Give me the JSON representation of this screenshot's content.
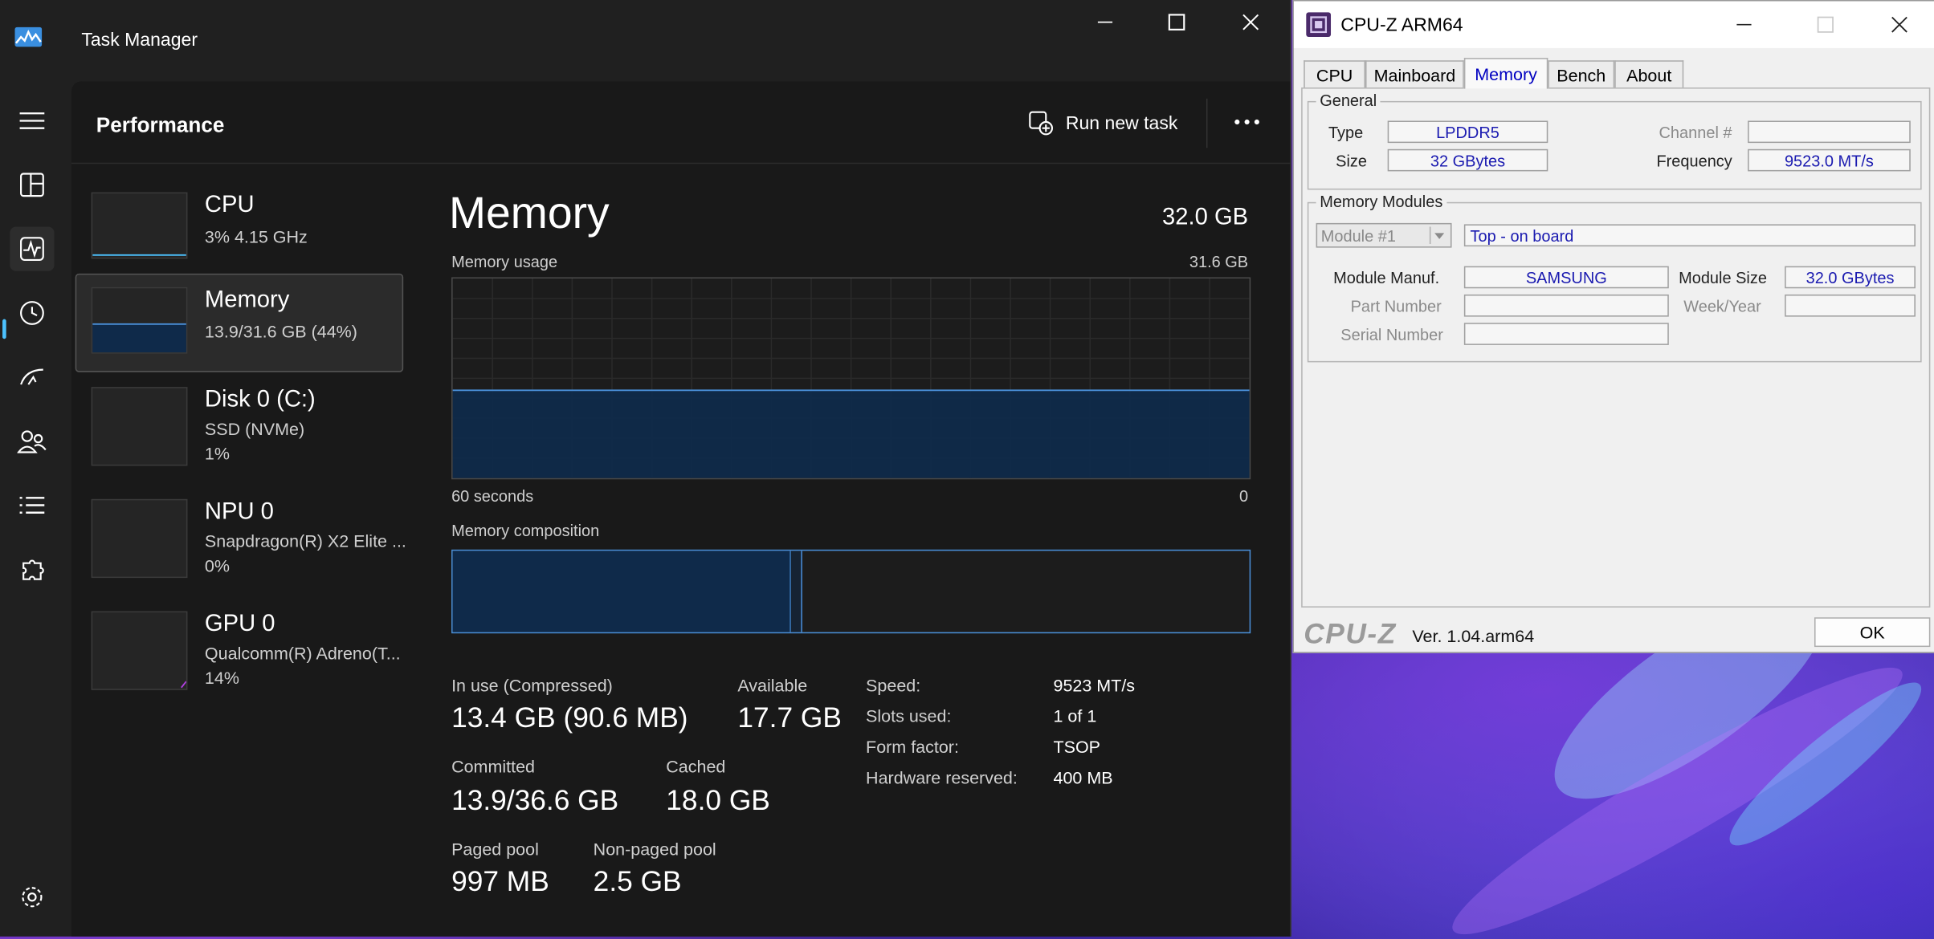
{
  "taskmanager": {
    "title": "Task Manager",
    "header": {
      "title": "Performance",
      "run_new_task": "Run new task",
      "more": "..."
    },
    "devices": [
      {
        "name": "CPU",
        "line1": "3%  4.15 GHz",
        "line2": ""
      },
      {
        "name": "Memory",
        "line1": "13.9/31.6 GB (44%)",
        "line2": ""
      },
      {
        "name": "Disk 0 (C:)",
        "line1": "SSD (NVMe)",
        "line2": "1%"
      },
      {
        "name": "NPU 0",
        "line1": "Snapdragon(R) X2 Elite ...",
        "line2": "0%"
      },
      {
        "name": "GPU 0",
        "line1": "Qualcomm(R) Adreno(T...",
        "line2": "14%"
      }
    ],
    "memory": {
      "title": "Memory",
      "total": "32.0 GB",
      "usage_label": "Memory usage",
      "usage_max": "31.6 GB",
      "axis_left": "60 seconds",
      "axis_right": "0",
      "usage_fraction": 0.44,
      "composition_label": "Memory composition",
      "composition": {
        "in_use_fraction": 0.424,
        "modified_fraction": 0.014
      },
      "stats": {
        "in_use_label": "In use (Compressed)",
        "in_use_value": "13.4 GB (90.6 MB)",
        "available_label": "Available",
        "available_value": "17.7 GB",
        "committed_label": "Committed",
        "committed_value": "13.9/36.6 GB",
        "cached_label": "Cached",
        "cached_value": "18.0 GB",
        "paged_label": "Paged pool",
        "paged_value": "997 MB",
        "nonpaged_label": "Non-paged pool",
        "nonpaged_value": "2.5 GB"
      },
      "specs": [
        {
          "label": "Speed:",
          "value": "9523 MT/s"
        },
        {
          "label": "Slots used:",
          "value": "1 of 1"
        },
        {
          "label": "Form factor:",
          "value": "TSOP"
        },
        {
          "label": "Hardware reserved:",
          "value": "400 MB"
        }
      ]
    },
    "colors": {
      "accent": "#4cc2ff",
      "memory_fill": "#0f2a4a",
      "memory_line": "#4a8fd8"
    }
  },
  "cpuz": {
    "title": "CPU-Z ARM64",
    "tabs": [
      "CPU",
      "Mainboard",
      "Memory",
      "Bench",
      "About"
    ],
    "active_tab": "Memory",
    "general": {
      "title": "General",
      "type_label": "Type",
      "type_value": "LPDDR5",
      "size_label": "Size",
      "size_value": "32 GBytes",
      "channel_label": "Channel #",
      "channel_value": "",
      "frequency_label": "Frequency",
      "frequency_value": "9523.0 MT/s"
    },
    "modules": {
      "title": "Memory Modules",
      "module_select": "Module #1",
      "module_location": "Top - on board",
      "manuf_label": "Module Manuf.",
      "manuf_value": "SAMSUNG",
      "size_label": "Module Size",
      "size_value": "32.0 GBytes",
      "part_label": "Part Number",
      "part_value": "",
      "week_label": "Week/Year",
      "week_value": "",
      "serial_label": "Serial Number",
      "serial_value": ""
    },
    "footer": {
      "logo": "CPU-Z",
      "version": "Ver. 1.04.arm64",
      "ok": "OK"
    }
  }
}
